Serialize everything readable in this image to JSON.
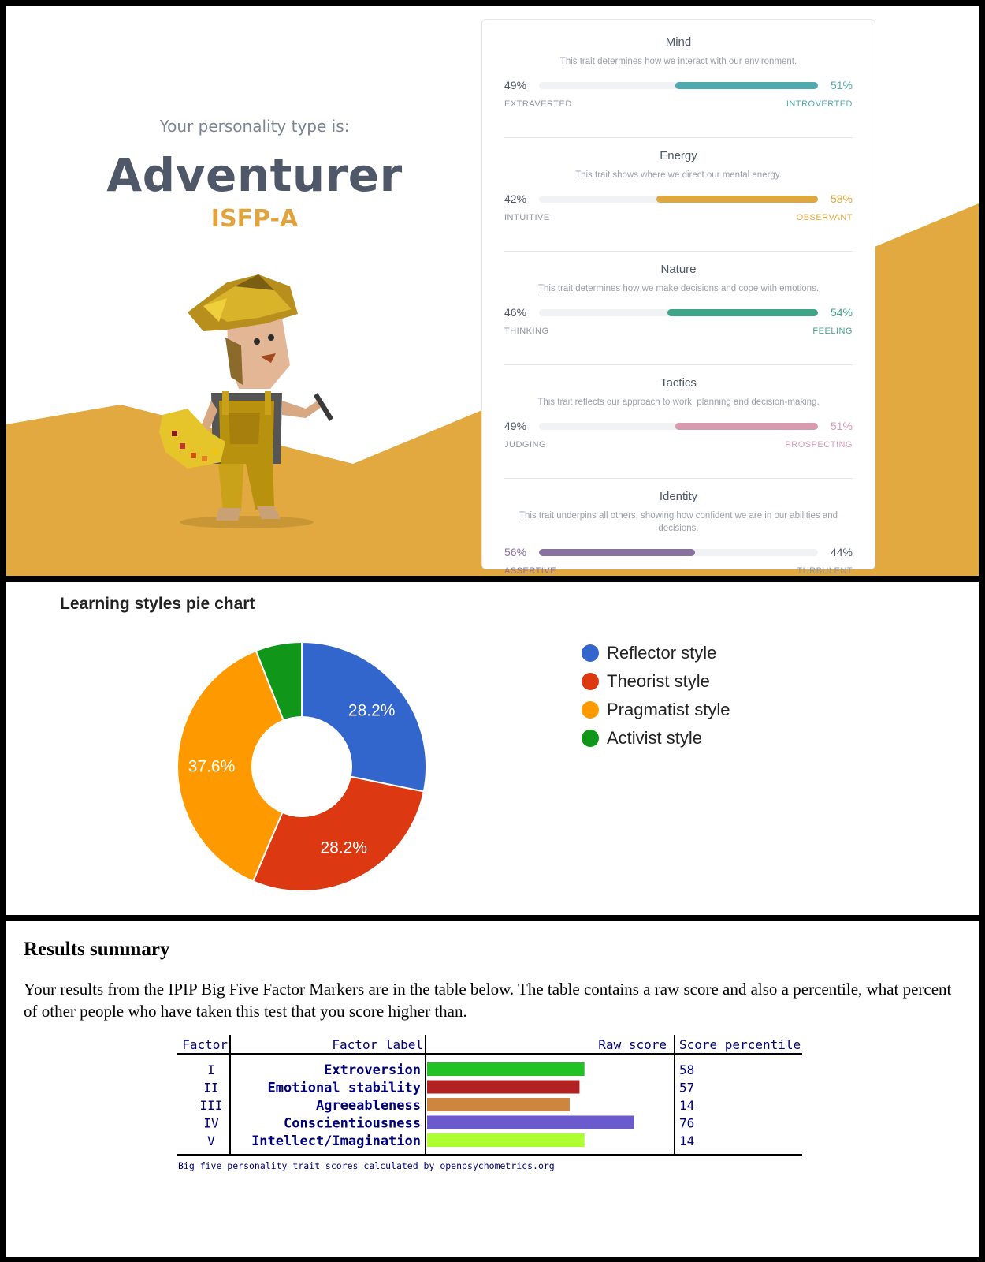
{
  "personality": {
    "intro": "Your personality type is:",
    "type_name": "Adventurer",
    "type_code": "ISFP-A",
    "traits": [
      {
        "name": "Mind",
        "description": "This trait determines how we interact with our environment.",
        "left_label": "EXTRAVERTED",
        "right_label": "INTROVERTED",
        "left_pct": "49%",
        "right_pct": "51%",
        "fill_side": "right",
        "value": 51,
        "color": "#4fa9ae"
      },
      {
        "name": "Energy",
        "description": "This trait shows where we direct our mental energy.",
        "left_label": "INTUITIVE",
        "right_label": "OBSERVANT",
        "left_pct": "42%",
        "right_pct": "58%",
        "fill_side": "right",
        "value": 58,
        "color": "#e0a73d"
      },
      {
        "name": "Nature",
        "description": "This trait determines how we make decisions and cope with emotions.",
        "left_label": "THINKING",
        "right_label": "FEELING",
        "left_pct": "46%",
        "right_pct": "54%",
        "fill_side": "right",
        "value": 54,
        "color": "#3fa588"
      },
      {
        "name": "Tactics",
        "description": "This trait reflects our approach to work, planning and decision-making.",
        "left_label": "JUDGING",
        "right_label": "PROSPECTING",
        "left_pct": "49%",
        "right_pct": "51%",
        "fill_side": "right",
        "value": 51,
        "color": "#d89aae"
      },
      {
        "name": "Identity",
        "description": "This trait underpins all others, showing how confident we are in our abilities and decisions.",
        "left_label": "ASSERTIVE",
        "right_label": "TURBULENT",
        "left_pct": "56%",
        "right_pct": "44%",
        "fill_side": "left",
        "value": 56,
        "color": "#88709f"
      }
    ]
  },
  "chart_data": [
    {
      "type": "pie",
      "title": "Learning styles pie chart",
      "donut": true,
      "legend_position": "right",
      "slices": [
        {
          "label": "Reflector style",
          "value": 28.2,
          "color": "#3366cc",
          "show_label": true
        },
        {
          "label": "Theorist style",
          "value": 28.2,
          "color": "#dc3912",
          "show_label": true
        },
        {
          "label": "Pragmatist style",
          "value": 37.6,
          "color": "#ff9900",
          "show_label": true
        },
        {
          "label": "Activist style",
          "value": 6.0,
          "color": "#109618",
          "show_label": false
        }
      ]
    },
    {
      "type": "bar",
      "orientation": "horizontal",
      "columns": [
        "Factor",
        "Factor label",
        "Raw score",
        "Score percentile"
      ],
      "footer": "Big five personality trait scores calculated by openpsychometrics.org",
      "rows": [
        {
          "factor": "I",
          "label": "Extroversion",
          "raw": 32,
          "percentile": "58",
          "color": "#22c224"
        },
        {
          "factor": "II",
          "label": "Emotional stability",
          "raw": 31,
          "percentile": "57",
          "color": "#b22222"
        },
        {
          "factor": "III",
          "label": "Agreeableness",
          "raw": 29,
          "percentile": "14",
          "color": "#cd853f"
        },
        {
          "factor": "IV",
          "label": "Conscientiousness",
          "raw": 42,
          "percentile": "76",
          "color": "#6a5acd"
        },
        {
          "factor": "V",
          "label": "Intellect/Imagination",
          "raw": 32,
          "percentile": "14",
          "color": "#adff2f"
        }
      ],
      "raw_max": 50
    }
  ],
  "bigfive": {
    "heading": "Results summary",
    "text": "Your results from the IPIP Big Five Factor Markers are in the table below. The table contains a raw score and also a percentile, what percent of other people who have taken this test that you score higher than."
  }
}
